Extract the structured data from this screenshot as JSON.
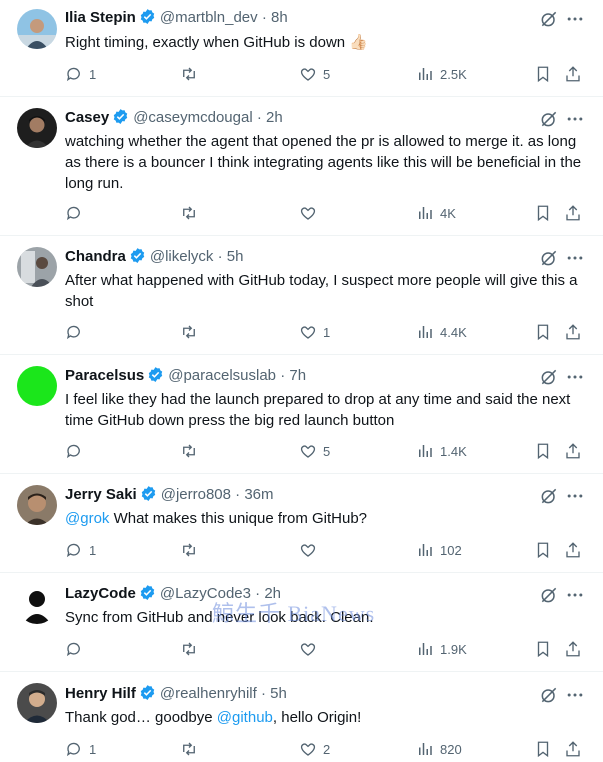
{
  "posts": [
    {
      "name": "Ilia Stepin",
      "handle": "@martbln_dev",
      "sep": "·",
      "time": "8h",
      "text_parts": [
        {
          "text": "Right timing, exactly when GitHub is down 👍🏻",
          "mention": false
        }
      ],
      "replies": "1",
      "reposts": "",
      "likes": "5",
      "views": "2.5K",
      "avatar_color": "#7fb6d8"
    },
    {
      "name": "Casey",
      "handle": "@caseymcdougal",
      "sep": "·",
      "time": "2h",
      "text_parts": [
        {
          "text": "watching whether the agent that opened the pr is allowed to merge it. as long as there is a bouncer I think integrating agents like this will be beneficial in the long run.",
          "mention": false
        }
      ],
      "replies": "",
      "reposts": "",
      "likes": "",
      "views": "4K",
      "avatar_color": "#2a2a2a"
    },
    {
      "name": "Chandra",
      "handle": "@likelyck",
      "sep": "·",
      "time": "5h",
      "text_parts": [
        {
          "text": "After what happened with GitHub today, I suspect more people will give this a shot",
          "mention": false
        }
      ],
      "replies": "",
      "reposts": "",
      "likes": "1",
      "views": "4.4K",
      "avatar_color": "#8a8f96"
    },
    {
      "name": "Paracelsus",
      "handle": "@paracelsuslab",
      "sep": "·",
      "time": "7h",
      "text_parts": [
        {
          "text": "I feel like they had the launch prepared to drop at any time and said the next time GitHub down press the big red launch button",
          "mention": false
        }
      ],
      "replies": "",
      "reposts": "",
      "likes": "5",
      "views": "1.4K",
      "avatar_color": "#1be61b"
    },
    {
      "name": "Jerry Saki",
      "handle": "@jerro808",
      "sep": "·",
      "time": "36m",
      "text_parts": [
        {
          "text": "@grok",
          "mention": true
        },
        {
          "text": " What makes this unique from GitHub?",
          "mention": false
        }
      ],
      "replies": "1",
      "reposts": "",
      "likes": "",
      "views": "102",
      "avatar_color": "#6b5a4a"
    },
    {
      "name": "LazyCode",
      "handle": "@LazyCode3",
      "sep": "·",
      "time": "2h",
      "text_parts": [
        {
          "text": "Sync from GitHub and never look back. Clean.",
          "mention": false
        }
      ],
      "replies": "",
      "reposts": "",
      "likes": "",
      "views": "1.9K",
      "avatar_color": "#ffffff"
    },
    {
      "name": "Henry Hilf",
      "handle": "@realhenryhilf",
      "sep": "·",
      "time": "5h",
      "text_parts": [
        {
          "text": "Thank god… goodbye ",
          "mention": false
        },
        {
          "text": "@github",
          "mention": true
        },
        {
          "text": ", hello Origin!",
          "mention": false
        }
      ],
      "replies": "1",
      "reposts": "",
      "likes": "2",
      "views": "820",
      "avatar_color": "#3d3d3d"
    }
  ],
  "watermark": "鯨生千 BiaNews",
  "colors": {
    "verified": "#1d9bf0",
    "muted": "#536471",
    "mention": "#1d9bf0"
  }
}
